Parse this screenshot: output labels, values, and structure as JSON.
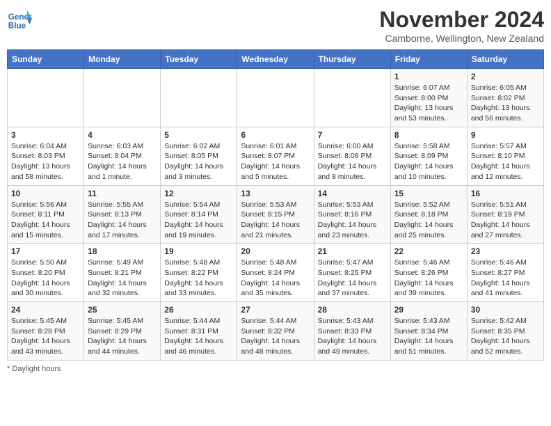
{
  "header": {
    "logo_line1": "General",
    "logo_line2": "Blue",
    "month_year": "November 2024",
    "location": "Camborne, Wellington, New Zealand"
  },
  "columns": [
    "Sunday",
    "Monday",
    "Tuesday",
    "Wednesday",
    "Thursday",
    "Friday",
    "Saturday"
  ],
  "weeks": [
    [
      {
        "day": "",
        "sunrise": "",
        "sunset": "",
        "daylight": ""
      },
      {
        "day": "",
        "sunrise": "",
        "sunset": "",
        "daylight": ""
      },
      {
        "day": "",
        "sunrise": "",
        "sunset": "",
        "daylight": ""
      },
      {
        "day": "",
        "sunrise": "",
        "sunset": "",
        "daylight": ""
      },
      {
        "day": "",
        "sunrise": "",
        "sunset": "",
        "daylight": ""
      },
      {
        "day": "1",
        "sunrise": "Sunrise: 6:07 AM",
        "sunset": "Sunset: 8:00 PM",
        "daylight": "Daylight: 13 hours and 53 minutes."
      },
      {
        "day": "2",
        "sunrise": "Sunrise: 6:05 AM",
        "sunset": "Sunset: 8:02 PM",
        "daylight": "Daylight: 13 hours and 56 minutes."
      }
    ],
    [
      {
        "day": "3",
        "sunrise": "Sunrise: 6:04 AM",
        "sunset": "Sunset: 8:03 PM",
        "daylight": "Daylight: 13 hours and 58 minutes."
      },
      {
        "day": "4",
        "sunrise": "Sunrise: 6:03 AM",
        "sunset": "Sunset: 8:04 PM",
        "daylight": "Daylight: 14 hours and 1 minute."
      },
      {
        "day": "5",
        "sunrise": "Sunrise: 6:02 AM",
        "sunset": "Sunset: 8:05 PM",
        "daylight": "Daylight: 14 hours and 3 minutes."
      },
      {
        "day": "6",
        "sunrise": "Sunrise: 6:01 AM",
        "sunset": "Sunset: 8:07 PM",
        "daylight": "Daylight: 14 hours and 5 minutes."
      },
      {
        "day": "7",
        "sunrise": "Sunrise: 6:00 AM",
        "sunset": "Sunset: 8:08 PM",
        "daylight": "Daylight: 14 hours and 8 minutes."
      },
      {
        "day": "8",
        "sunrise": "Sunrise: 5:58 AM",
        "sunset": "Sunset: 8:09 PM",
        "daylight": "Daylight: 14 hours and 10 minutes."
      },
      {
        "day": "9",
        "sunrise": "Sunrise: 5:57 AM",
        "sunset": "Sunset: 8:10 PM",
        "daylight": "Daylight: 14 hours and 12 minutes."
      }
    ],
    [
      {
        "day": "10",
        "sunrise": "Sunrise: 5:56 AM",
        "sunset": "Sunset: 8:11 PM",
        "daylight": "Daylight: 14 hours and 15 minutes."
      },
      {
        "day": "11",
        "sunrise": "Sunrise: 5:55 AM",
        "sunset": "Sunset: 8:13 PM",
        "daylight": "Daylight: 14 hours and 17 minutes."
      },
      {
        "day": "12",
        "sunrise": "Sunrise: 5:54 AM",
        "sunset": "Sunset: 8:14 PM",
        "daylight": "Daylight: 14 hours and 19 minutes."
      },
      {
        "day": "13",
        "sunrise": "Sunrise: 5:53 AM",
        "sunset": "Sunset: 8:15 PM",
        "daylight": "Daylight: 14 hours and 21 minutes."
      },
      {
        "day": "14",
        "sunrise": "Sunrise: 5:53 AM",
        "sunset": "Sunset: 8:16 PM",
        "daylight": "Daylight: 14 hours and 23 minutes."
      },
      {
        "day": "15",
        "sunrise": "Sunrise: 5:52 AM",
        "sunset": "Sunset: 8:18 PM",
        "daylight": "Daylight: 14 hours and 25 minutes."
      },
      {
        "day": "16",
        "sunrise": "Sunrise: 5:51 AM",
        "sunset": "Sunset: 8:19 PM",
        "daylight": "Daylight: 14 hours and 27 minutes."
      }
    ],
    [
      {
        "day": "17",
        "sunrise": "Sunrise: 5:50 AM",
        "sunset": "Sunset: 8:20 PM",
        "daylight": "Daylight: 14 hours and 30 minutes."
      },
      {
        "day": "18",
        "sunrise": "Sunrise: 5:49 AM",
        "sunset": "Sunset: 8:21 PM",
        "daylight": "Daylight: 14 hours and 32 minutes."
      },
      {
        "day": "19",
        "sunrise": "Sunrise: 5:48 AM",
        "sunset": "Sunset: 8:22 PM",
        "daylight": "Daylight: 14 hours and 33 minutes."
      },
      {
        "day": "20",
        "sunrise": "Sunrise: 5:48 AM",
        "sunset": "Sunset: 8:24 PM",
        "daylight": "Daylight: 14 hours and 35 minutes."
      },
      {
        "day": "21",
        "sunrise": "Sunrise: 5:47 AM",
        "sunset": "Sunset: 8:25 PM",
        "daylight": "Daylight: 14 hours and 37 minutes."
      },
      {
        "day": "22",
        "sunrise": "Sunrise: 5:46 AM",
        "sunset": "Sunset: 8:26 PM",
        "daylight": "Daylight: 14 hours and 39 minutes."
      },
      {
        "day": "23",
        "sunrise": "Sunrise: 5:46 AM",
        "sunset": "Sunset: 8:27 PM",
        "daylight": "Daylight: 14 hours and 41 minutes."
      }
    ],
    [
      {
        "day": "24",
        "sunrise": "Sunrise: 5:45 AM",
        "sunset": "Sunset: 8:28 PM",
        "daylight": "Daylight: 14 hours and 43 minutes."
      },
      {
        "day": "25",
        "sunrise": "Sunrise: 5:45 AM",
        "sunset": "Sunset: 8:29 PM",
        "daylight": "Daylight: 14 hours and 44 minutes."
      },
      {
        "day": "26",
        "sunrise": "Sunrise: 5:44 AM",
        "sunset": "Sunset: 8:31 PM",
        "daylight": "Daylight: 14 hours and 46 minutes."
      },
      {
        "day": "27",
        "sunrise": "Sunrise: 5:44 AM",
        "sunset": "Sunset: 8:32 PM",
        "daylight": "Daylight: 14 hours and 48 minutes."
      },
      {
        "day": "28",
        "sunrise": "Sunrise: 5:43 AM",
        "sunset": "Sunset: 8:33 PM",
        "daylight": "Daylight: 14 hours and 49 minutes."
      },
      {
        "day": "29",
        "sunrise": "Sunrise: 5:43 AM",
        "sunset": "Sunset: 8:34 PM",
        "daylight": "Daylight: 14 hours and 51 minutes."
      },
      {
        "day": "30",
        "sunrise": "Sunrise: 5:42 AM",
        "sunset": "Sunset: 8:35 PM",
        "daylight": "Daylight: 14 hours and 52 minutes."
      }
    ]
  ],
  "footer": {
    "daylight_note": "Daylight hours"
  }
}
